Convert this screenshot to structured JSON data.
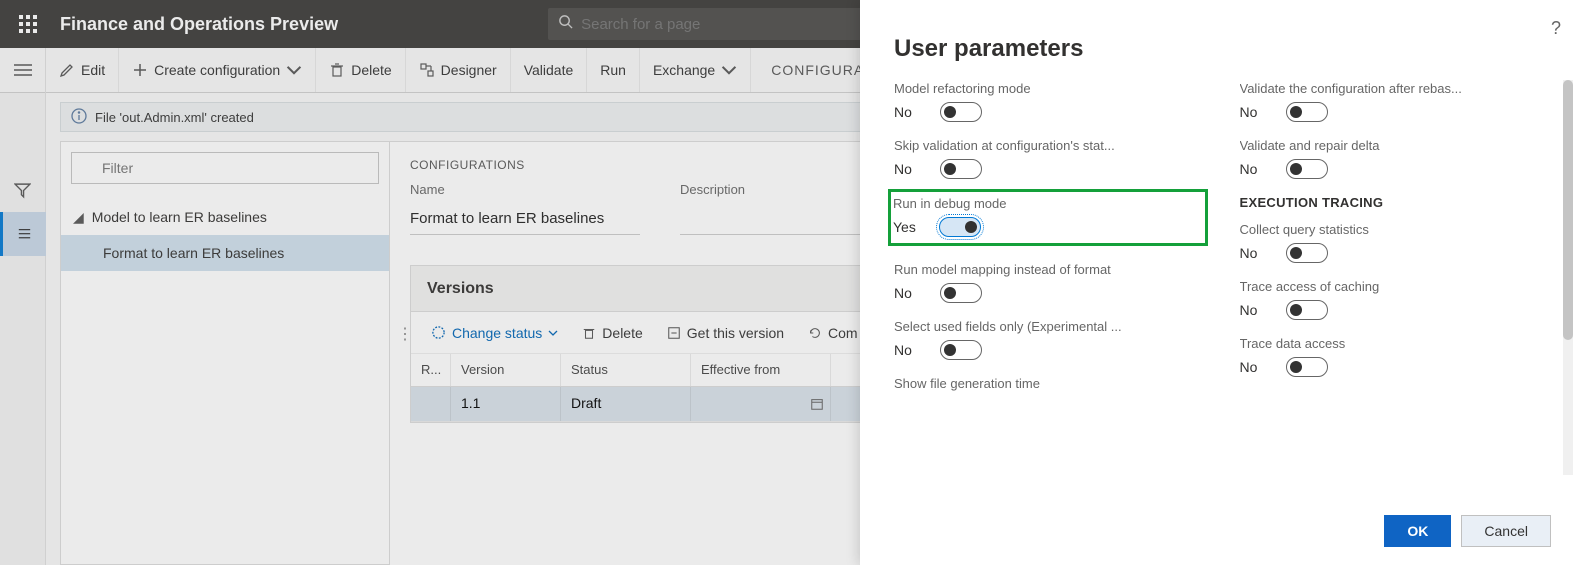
{
  "header": {
    "app_title": "Finance and Operations Preview",
    "search_placeholder": "Search for a page"
  },
  "toolbar": {
    "edit": "Edit",
    "create_config": "Create configuration",
    "delete": "Delete",
    "designer": "Designer",
    "validate": "Validate",
    "run": "Run",
    "exchange": "Exchange",
    "breadcrumb": "CONFIGURAT"
  },
  "info_bar": "File 'out.Admin.xml' created",
  "filter_placeholder": "Filter",
  "tree": {
    "parent": "Model to learn ER baselines",
    "child": "Format to learn ER baselines"
  },
  "details": {
    "section": "CONFIGURATIONS",
    "name_label": "Name",
    "name_value": "Format to learn ER baselines",
    "desc_label": "Description"
  },
  "versions": {
    "title": "Versions",
    "change_status": "Change status",
    "delete": "Delete",
    "get_this": "Get this version",
    "com": "Com",
    "cols": {
      "r": "R...",
      "version": "Version",
      "status": "Status",
      "eff": "Effective from"
    },
    "row": {
      "version": "1.1",
      "status": "Draft"
    }
  },
  "panel": {
    "title": "User parameters",
    "items_left": [
      {
        "label": "Model refactoring mode",
        "value": "No",
        "on": false
      },
      {
        "label": "Skip validation at configuration's stat...",
        "value": "No",
        "on": false
      },
      {
        "label": "Run in debug mode",
        "value": "Yes",
        "on": true,
        "highlighted": true
      },
      {
        "label": "Run model mapping instead of format",
        "value": "No",
        "on": false
      },
      {
        "label": "Select used fields only (Experimental ...",
        "value": "No",
        "on": false
      },
      {
        "label": "Show file generation time",
        "value": "",
        "on": null,
        "noToggle": true
      }
    ],
    "items_right_top": [
      {
        "label": "Validate the configuration after rebas...",
        "value": "No",
        "on": false
      },
      {
        "label": "Validate and repair delta",
        "value": "No",
        "on": false
      }
    ],
    "exec_tracing_heading": "EXECUTION TRACING",
    "items_right_bottom": [
      {
        "label": "Collect query statistics",
        "value": "No",
        "on": false
      },
      {
        "label": "Trace access of caching",
        "value": "No",
        "on": false
      },
      {
        "label": "Trace data access",
        "value": "No",
        "on": false
      }
    ],
    "ok": "OK",
    "cancel": "Cancel"
  }
}
